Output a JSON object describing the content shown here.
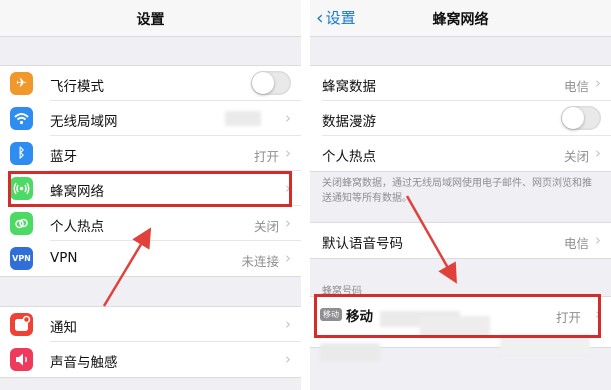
{
  "left": {
    "title": "设置",
    "group1": [
      {
        "label": "飞行模式",
        "icon": "airplane-icon",
        "color": "#f0982c",
        "toggle": false
      },
      {
        "label": "无线局域网",
        "icon": "wifi-icon",
        "color": "#2f8cf0"
      },
      {
        "label": "蓝牙",
        "icon": "bluetooth-icon",
        "color": "#2f8cf0",
        "value": "打开"
      },
      {
        "label": "蜂窝网络",
        "icon": "cellular-icon",
        "color": "#4cd964"
      },
      {
        "label": "个人热点",
        "icon": "hotspot-icon",
        "color": "#4cd964",
        "value": "关闭"
      },
      {
        "label": "VPN",
        "icon": "vpn-icon",
        "color": "#2f6fd6",
        "value": "未连接"
      }
    ],
    "group2": [
      {
        "label": "通知",
        "icon": "notifications-icon",
        "color": "#ef4237"
      },
      {
        "label": "声音与触感",
        "icon": "sound-icon",
        "color": "#ef3a5d"
      }
    ]
  },
  "right": {
    "back_label": "设置",
    "title": "蜂窝网络",
    "group1": [
      {
        "label": "蜂窝数据",
        "value": "电信"
      },
      {
        "label": "数据漫游",
        "toggle": false
      },
      {
        "label": "个人热点",
        "value": "关闭"
      }
    ],
    "footer_note": "关闭蜂窝数据，通过无线局域网使用电子邮件、网页浏览和推送通知等所有数据。",
    "group2": [
      {
        "label": "默认语音号码",
        "value": "电信"
      }
    ],
    "section_header": "蜂窝号码",
    "sim": {
      "badge": "移动",
      "name": "移动",
      "value": "打开"
    }
  },
  "colors": {
    "highlight": "#d62b2b",
    "link": "#1677d6",
    "arrow": "#e0413a"
  }
}
